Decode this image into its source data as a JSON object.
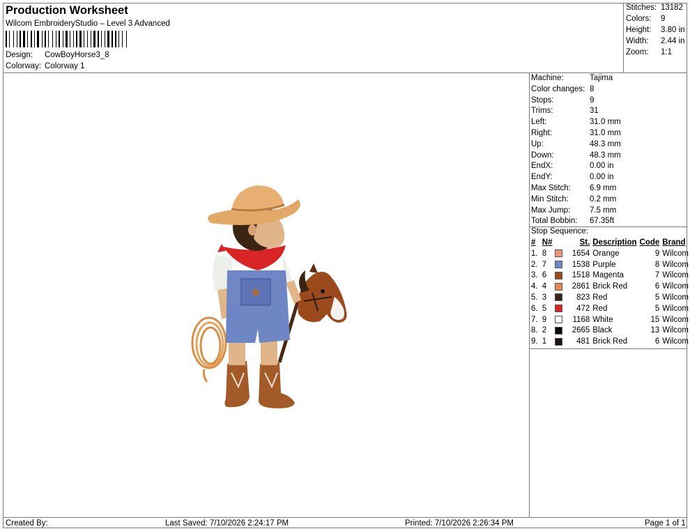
{
  "header": {
    "title": "Production Worksheet",
    "software": "Wilcom EmbroideryStudio – Level 3 Advanced",
    "design_label": "Design:",
    "design_value": "CowBoyHorse3_8",
    "colorway_label": "Colorway:",
    "colorway_value": "Colorway 1"
  },
  "summary": {
    "stitches_label": "Stitches:",
    "stitches": "13182",
    "colors_label": "Colors:",
    "colors": "9",
    "height_label": "Height:",
    "height": "3.80 in",
    "width_label": "Width:",
    "width": "2.44 in",
    "zoom_label": "Zoom:",
    "zoom": "1:1"
  },
  "machine_info": [
    {
      "label": "Machine:",
      "value": "Tajima"
    },
    {
      "label": "Color changes:",
      "value": "8"
    },
    {
      "label": "Stops:",
      "value": "9"
    },
    {
      "label": "Trims:",
      "value": "31"
    },
    {
      "label": "Left:",
      "value": "31.0 mm"
    },
    {
      "label": "Right:",
      "value": "31.0 mm"
    },
    {
      "label": "Up:",
      "value": "48.3 mm"
    },
    {
      "label": "Down:",
      "value": "48.3 mm"
    },
    {
      "label": "EndX:",
      "value": "0.00 in"
    },
    {
      "label": "EndY:",
      "value": "0.00 in"
    },
    {
      "label": "Max Stitch:",
      "value": "6.9 mm"
    },
    {
      "label": "Min Stitch:",
      "value": "0.2 mm"
    },
    {
      "label": "Max Jump:",
      "value": "7.5 mm"
    },
    {
      "label": "Total Bobbin:",
      "value": "67.35ft"
    }
  ],
  "stop_sequence": {
    "label": "Stop Sequence:",
    "headers": [
      "#",
      "N#",
      "St.",
      "Description",
      "Code",
      "Brand"
    ],
    "rows": [
      {
        "idx": "1.",
        "n": "8",
        "color": "#e8967a",
        "st": "1654",
        "desc": "Orange",
        "code": "9",
        "brand": "Wilcom"
      },
      {
        "idx": "2.",
        "n": "7",
        "color": "#6f86c4",
        "st": "1538",
        "desc": "Purple",
        "code": "8",
        "brand": "Wilcom"
      },
      {
        "idx": "3.",
        "n": "6",
        "color": "#9a4a1c",
        "st": "1518",
        "desc": "Magenta",
        "code": "7",
        "brand": "Wilcom"
      },
      {
        "idx": "4.",
        "n": "4",
        "color": "#e28a52",
        "st": "2861",
        "desc": "Brick Red",
        "code": "6",
        "brand": "Wilcom"
      },
      {
        "idx": "5.",
        "n": "3",
        "color": "#3b2412",
        "st": "823",
        "desc": "Red",
        "code": "5",
        "brand": "Wilcom"
      },
      {
        "idx": "6.",
        "n": "5",
        "color": "#d82424",
        "st": "472",
        "desc": "Red",
        "code": "5",
        "brand": "Wilcom"
      },
      {
        "idx": "7.",
        "n": "9",
        "color": "#ffffff",
        "st": "1168",
        "desc": "White",
        "code": "15",
        "brand": "Wilcom"
      },
      {
        "idx": "8.",
        "n": "2",
        "color": "#0a0a0a",
        "st": "2665",
        "desc": "Black",
        "code": "13",
        "brand": "Wilcom"
      },
      {
        "idx": "9.",
        "n": "1",
        "color": "#1a1310",
        "st": "481",
        "desc": "Brick Red",
        "code": "6",
        "brand": "Wilcom"
      }
    ]
  },
  "footer": {
    "created_by": "Created By:",
    "last_saved": "Last Saved: 7/10/2026 2:24:17 PM",
    "printed": "Printed: 7/10/2026 2:26:34 PM",
    "page": "Page 1 of 1"
  }
}
